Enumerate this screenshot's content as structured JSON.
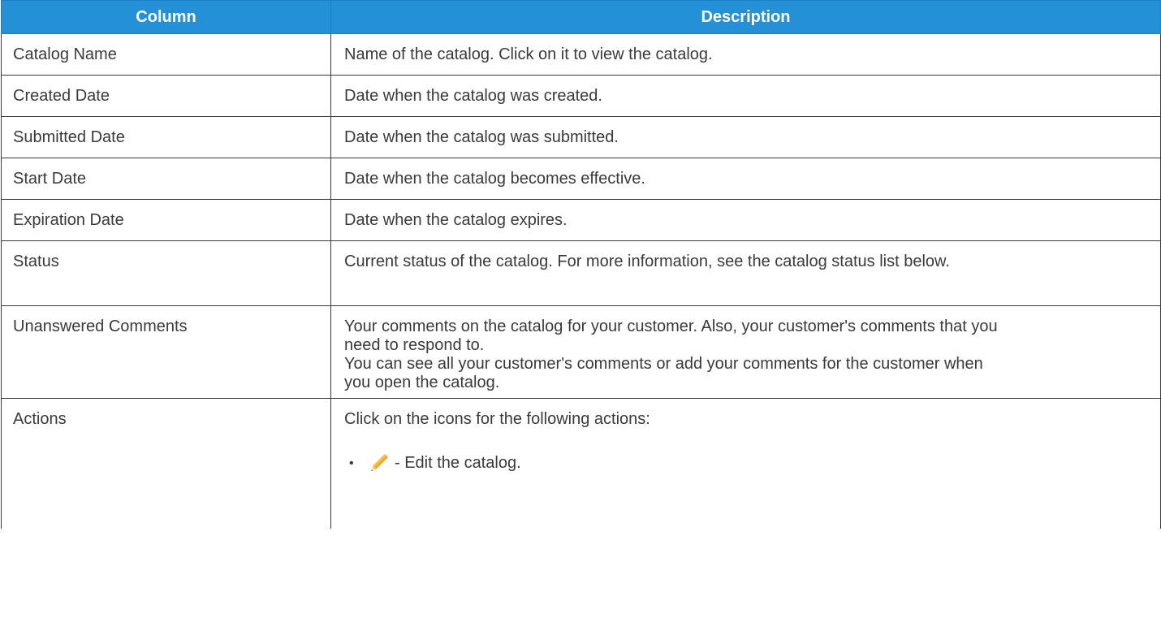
{
  "table": {
    "headers": [
      "Column",
      "Description"
    ],
    "rows": [
      {
        "column": "Catalog Name",
        "description": [
          "Name of the catalog. Click on it to view the catalog."
        ]
      },
      {
        "column": "Created Date",
        "description": [
          "Date when the catalog was created."
        ]
      },
      {
        "column": "Submitted Date",
        "description": [
          "Date when the catalog was submitted."
        ]
      },
      {
        "column": "Start Date",
        "description": [
          "Date when the catalog becomes effective."
        ]
      },
      {
        "column": "Expiration Date",
        "description": [
          "Date when the catalog expires."
        ]
      },
      {
        "column": "Status",
        "description": [
          "Current status of the catalog. For more information, see the catalog status list below."
        ]
      },
      {
        "column": "Unanswered Comments",
        "description": [
          "Your comments on the catalog for your customer. Also, your customer's comments that you need to respond to.",
          "You can see all your customer's comments or add your comments for the customer when you open the catalog."
        ]
      },
      {
        "column": "Actions",
        "description": [
          "Click on the icons for the following actions:"
        ]
      }
    ],
    "actions": [
      {
        "icon": "pencil-icon",
        "bullet": "•",
        "text": "- Edit the catalog."
      }
    ]
  },
  "colors": {
    "header_bg": "#2490d6",
    "header_text": "#ffffff",
    "body_text": "#3a3a3a",
    "border": "#3a3a3a",
    "pencil_body": "#f5a623",
    "pencil_tip": "#f0d9a8"
  }
}
